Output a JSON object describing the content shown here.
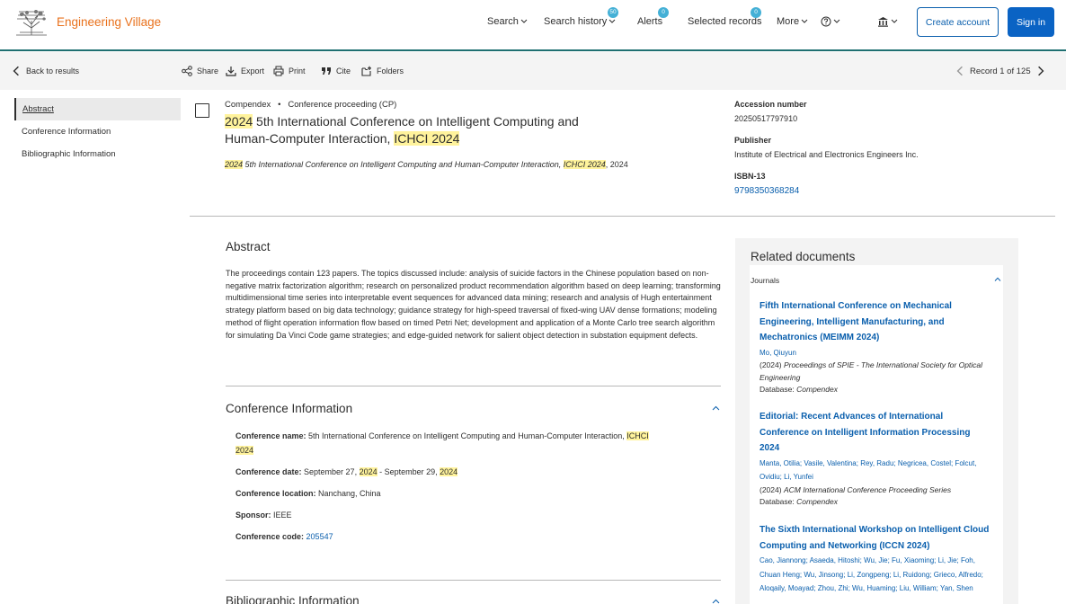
{
  "header": {
    "brand": "Engineering Village",
    "nav": [
      {
        "label": "Search"
      },
      {
        "label": "Search history",
        "badge": "50"
      },
      {
        "label": "Alerts",
        "badge": "0"
      },
      {
        "label": "Selected records",
        "badge": "0"
      },
      {
        "label": "More"
      }
    ],
    "create_account": "Create account",
    "sign_in": "Sign in"
  },
  "toolbar": {
    "back": "Back to results",
    "share": "Share",
    "export": "Export",
    "print": "Print",
    "cite": "Cite",
    "folders": "Folders",
    "record": "Record 1 of 125"
  },
  "left_nav": [
    {
      "label": "Abstract"
    },
    {
      "label": "Conference Information"
    },
    {
      "label": "Bibliographic Information"
    }
  ],
  "record": {
    "database": "Compendex",
    "doc_type": "Conference proceeding (CP)",
    "title_hl1": "2024",
    "title_mid": " 5th International Conference on Intelligent Computing and Human-Computer Interaction, ",
    "title_hl2": "ICHCI 2024",
    "source_hl1": "2024",
    "source_mid": " 5th International Conference on Intelligent Computing and Human-Computer Interaction, ",
    "source_hl2": "ICHCI 2024",
    "source_year": ", 2024",
    "accession_label": "Accession number",
    "accession_value": "20250517797910",
    "publisher_label": "Publisher",
    "publisher_value": "Institute of Electrical and Electronics Engineers Inc.",
    "isbn_label": "ISBN-13",
    "isbn_value": "9798350368284"
  },
  "abstract": {
    "heading": "Abstract",
    "text": "The proceedings contain 123 papers. The topics discussed include: analysis of suicide factors in the Chinese population based on non-negative matrix factorization algorithm; research on personalized product recommendation algorithm based on deep learning; transforming multidimensional time series into interpretable event sequences for advanced data mining; research and analysis of Hugh entertainment strategy platform based on big data technology; guidance strategy for high-speed traversal of fixed-wing UAV dense formations; modeling method of flight operation information flow based on timed Petri Net; development and application of a Monte Carlo tree search algorithm for simulating Da Vinci Code game strategies; and edge-guided network for salient object detection in substation equipment defects."
  },
  "conference": {
    "heading": "Conference Information",
    "name_label": "Conference name:",
    "name_value": " 5th International Conference on Intelligent Computing and Human-Computer Interaction, ",
    "name_hl1": "ICHCI",
    "name_hl2": "2024",
    "date_label": "Conference date:",
    "date_pre": " September 27, ",
    "date_hl1": "2024",
    "date_mid": " - September 29, ",
    "date_hl2": "2024",
    "location_label": "Conference location:",
    "location_value": " Nanchang, China",
    "sponsor_label": "Sponsor:",
    "sponsor_value": " IEEE",
    "code_label": "Conference code:",
    "code_value": "205547"
  },
  "bibliographic": {
    "heading": "Bibliographic Information"
  },
  "related": {
    "heading": "Related documents",
    "group": "Journals",
    "items": [
      {
        "title": "Fifth International Conference on Mechanical Engineering, Intelligent Manufacturing, and Mechatronics (MEIMM 2024)",
        "authors": "Mo, Qiuyun",
        "year": "(2024) ",
        "pub": "Proceedings of SPIE - The International Society for Optical Engineering",
        "db_label": "Database: ",
        "db": "Compendex"
      },
      {
        "title": "Editorial: Recent Advances of International Conference on Intelligent Information Processing 2024",
        "authors": "Manta, Otilia;  Vasile, Valentina;  Rey, Radu;  Negricea, Costel;  Folcut, Ovidiu;  Li, Yunfei",
        "year": "(2024) ",
        "pub": "ACM International Conference Proceeding Series",
        "db_label": "Database: ",
        "db": "Compendex"
      },
      {
        "title": "The Sixth International Workshop on Intelligent Cloud Computing and Networking (ICCN 2024)",
        "authors": "Cao, Jiannong;  Asaeda, Hitoshi;  Wu, Jie;  Fu, Xiaoming;  Li, Jie;  Foh, Chuan Heng;  Wu, Jinsong;  Li, Zongpeng;  Li, Ruidong;  Grieco, Alfredo;  Aloqaily, Moayad;  Zhou, Zhi;  Wu, Huaming;  Liu, William;  Yan, Shen",
        "year": "",
        "pub": "",
        "db_label": "",
        "db": ""
      }
    ]
  }
}
